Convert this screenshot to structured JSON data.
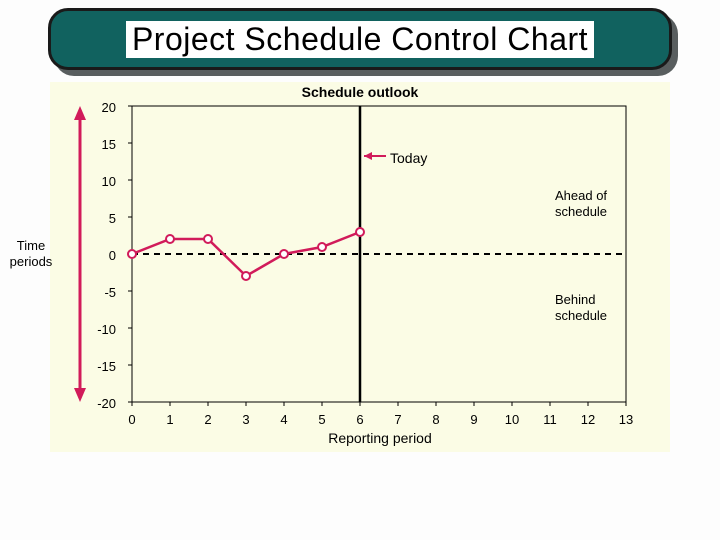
{
  "title": "Project Schedule Control Chart",
  "chart_data": {
    "type": "line",
    "title": "Schedule outlook",
    "xlabel": "Reporting period",
    "ylabel": "Time periods",
    "xlim": [
      0,
      13
    ],
    "ylim": [
      -20,
      20
    ],
    "x": [
      0,
      1,
      2,
      3,
      4,
      5,
      6
    ],
    "values": [
      0,
      2,
      2,
      -3,
      0,
      1,
      3
    ],
    "today_x": 6,
    "annotations": {
      "today": "Today",
      "ahead": "Ahead of schedule",
      "behind": "Behind schedule"
    },
    "y_ticks": [
      20,
      15,
      10,
      5,
      0,
      -5,
      -10,
      -15,
      -20
    ],
    "x_ticks": [
      0,
      1,
      2,
      3,
      4,
      5,
      6,
      7,
      8,
      9,
      10,
      11,
      12,
      13
    ],
    "colors": {
      "series": "#d11b5a",
      "axis": "#000",
      "arrow": "#d11b5a"
    }
  }
}
